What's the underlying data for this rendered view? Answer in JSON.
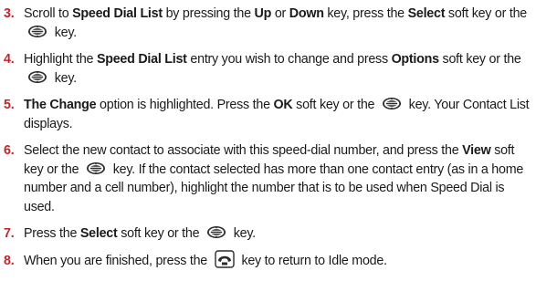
{
  "steps": [
    {
      "number": "3.",
      "parts": [
        {
          "t": "text",
          "v": "Scroll to "
        },
        {
          "t": "bold",
          "v": "Speed Dial List"
        },
        {
          "t": "text",
          "v": " by pressing the "
        },
        {
          "t": "bold",
          "v": "Up"
        },
        {
          "t": "text",
          "v": " or "
        },
        {
          "t": "bold",
          "v": "Down"
        },
        {
          "t": "text",
          "v": " key, press the "
        },
        {
          "t": "bold",
          "v": "Select"
        },
        {
          "t": "text",
          "v": " soft key or the "
        },
        {
          "t": "icon",
          "v": "select-key-icon"
        },
        {
          "t": "text",
          "v": " key."
        }
      ]
    },
    {
      "number": "4.",
      "parts": [
        {
          "t": "text",
          "v": "Highlight the "
        },
        {
          "t": "bold",
          "v": "Speed Dial List"
        },
        {
          "t": "text",
          "v": " entry you wish to change and press "
        },
        {
          "t": "bold",
          "v": "Options"
        },
        {
          "t": "text",
          "v": " soft key or the "
        },
        {
          "t": "icon",
          "v": "select-key-icon"
        },
        {
          "t": "text",
          "v": " key."
        }
      ]
    },
    {
      "number": "5.",
      "parts": [
        {
          "t": "bold",
          "v": "The Change"
        },
        {
          "t": "text",
          "v": " option is highlighted. Press the "
        },
        {
          "t": "bold",
          "v": "OK"
        },
        {
          "t": "text",
          "v": " soft key or the "
        },
        {
          "t": "icon",
          "v": "select-key-icon"
        },
        {
          "t": "text",
          "v": " key. Your Contact List displays."
        }
      ]
    },
    {
      "number": "6.",
      "parts": [
        {
          "t": "text",
          "v": "Select the new contact to associate with this speed-dial number, and press the "
        },
        {
          "t": "bold",
          "v": "View"
        },
        {
          "t": "text",
          "v": " soft key or the "
        },
        {
          "t": "icon",
          "v": "select-key-icon"
        },
        {
          "t": "text",
          "v": " key. If the contact selected has more than one contact entry (as in a home number and a cell number), highlight the number that is to be used when Speed Dial is used."
        }
      ]
    },
    {
      "number": "7.",
      "parts": [
        {
          "t": "text",
          "v": "Press the "
        },
        {
          "t": "bold",
          "v": "Select"
        },
        {
          "t": "text",
          "v": " soft key or the "
        },
        {
          "t": "icon",
          "v": "select-key-icon"
        },
        {
          "t": "text",
          "v": " key."
        }
      ]
    },
    {
      "number": "8.",
      "parts": [
        {
          "t": "text",
          "v": "When you are finished, press the "
        },
        {
          "t": "icon",
          "v": "end-key-icon"
        },
        {
          "t": "text",
          "v": " key to return to Idle mode."
        }
      ]
    }
  ]
}
